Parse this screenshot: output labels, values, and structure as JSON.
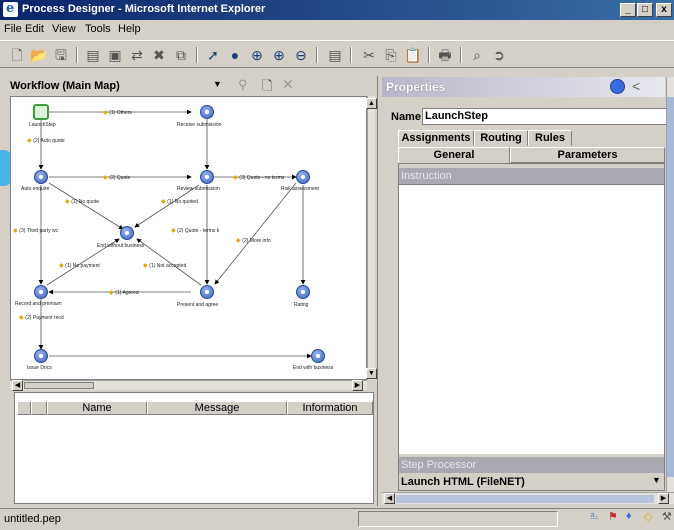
{
  "window": {
    "title": "Process Designer - Microsoft Internet Explorer",
    "minimize": "_",
    "maximize": "□",
    "close": "x"
  },
  "menu": [
    "File",
    "Edit",
    "View",
    "Tools",
    "Help"
  ],
  "workflow": {
    "selector_label": "Workflow (Main Map)",
    "nodes": [
      "LaunchStep",
      "Receive submission",
      "Auto enquire",
      "Review submission",
      "Risk assessment",
      "End without business",
      "Record and premium",
      "Present and agree",
      "Rating",
      "Issue Docs",
      "End with business"
    ],
    "routes": [
      "(1) Others",
      "(2) Auto quote",
      "(2) Quote",
      "(3) Quote - no terms",
      "(1) No quote",
      "(1) No quoted",
      "(3) Third party wc",
      "(2) Quote - terms k",
      "(2) More info",
      "(1) No payment",
      "(1) Not accepted",
      "(1) Agreed",
      "(2) Payment recd"
    ]
  },
  "grid": {
    "columns": [
      "Name",
      "Message",
      "Information"
    ]
  },
  "properties": {
    "title": "Properties",
    "name_label": "Name",
    "name_value": "LaunchStep",
    "tabs_row1": [
      "Assignments",
      "Routing",
      "Rules"
    ],
    "tabs_row2": [
      "General",
      "Parameters"
    ],
    "instruction_label": "Instruction",
    "step_processor_label": "Step Processor",
    "step_processor_value": "Launch HTML (FileNET)"
  },
  "status": {
    "file": "untitled.pep"
  }
}
